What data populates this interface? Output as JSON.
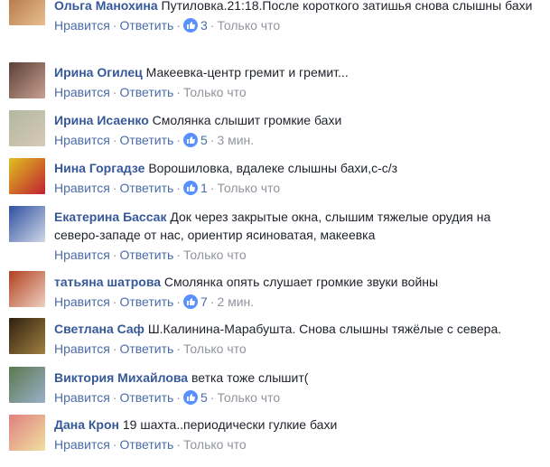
{
  "labels": {
    "like": "Нравится",
    "reply": "Ответить",
    "sep": "·"
  },
  "comments": [
    {
      "author": "Ольга Манохина",
      "text": "Путиловка.21:18.После короткого затишья снова слышны бахи",
      "likes": "3",
      "time": "Только что",
      "avatar_colors": [
        "#b07040",
        "#e8c090"
      ]
    },
    {
      "author": "Ирина Огилец",
      "text": "Макеевка-центр гремит и гремит...",
      "likes": "",
      "time": "Только что",
      "avatar_colors": [
        "#5a4038",
        "#c8a090"
      ]
    },
    {
      "author": "Ирина Исаенко",
      "text": "Смолянка слышит громкие бахи",
      "likes": "5",
      "time": "3 мин.",
      "avatar_colors": [
        "#b0b8a0",
        "#d8c8b8"
      ]
    },
    {
      "author": "Нина Горгадзе",
      "text": "Ворошиловка, вдалеке слышны бахи,с-с/з",
      "likes": "1",
      "time": "Только что",
      "avatar_colors": [
        "#e0c020",
        "#c02030"
      ]
    },
    {
      "author": "Екатерина Бассак",
      "text": "Док через закрытые окна, слышим тяжелые орудия на северо-западе от нас, ориентир ясиноватая, макеевка",
      "likes": "",
      "time": "Только что",
      "avatar_colors": [
        "#3050a0",
        "#d0d8e8"
      ]
    },
    {
      "author": "татьяна шатрова",
      "text": "Смолянка опять слушает громкие звуки войны",
      "likes": "7",
      "time": "2 мин.",
      "avatar_colors": [
        "#b04020",
        "#f0d0c0"
      ]
    },
    {
      "author": "Светлана Саф",
      "text": "Ш.Калинина-Марабушта. Снова слышны тяжёлые с севера.",
      "likes": "",
      "time": "Только что",
      "avatar_colors": [
        "#302010",
        "#a08040"
      ]
    },
    {
      "author": "Виктория Михайлова",
      "text": "ветка тоже слышит(",
      "likes": "5",
      "time": "Только что",
      "avatar_colors": [
        "#5a7850",
        "#9ab0c8"
      ]
    },
    {
      "author": "Дана Крон",
      "text": "19 шахта..периодически гулкие бахи",
      "likes": "",
      "time": "Только что",
      "avatar_colors": [
        "#e08080",
        "#f0e0a0"
      ]
    }
  ]
}
